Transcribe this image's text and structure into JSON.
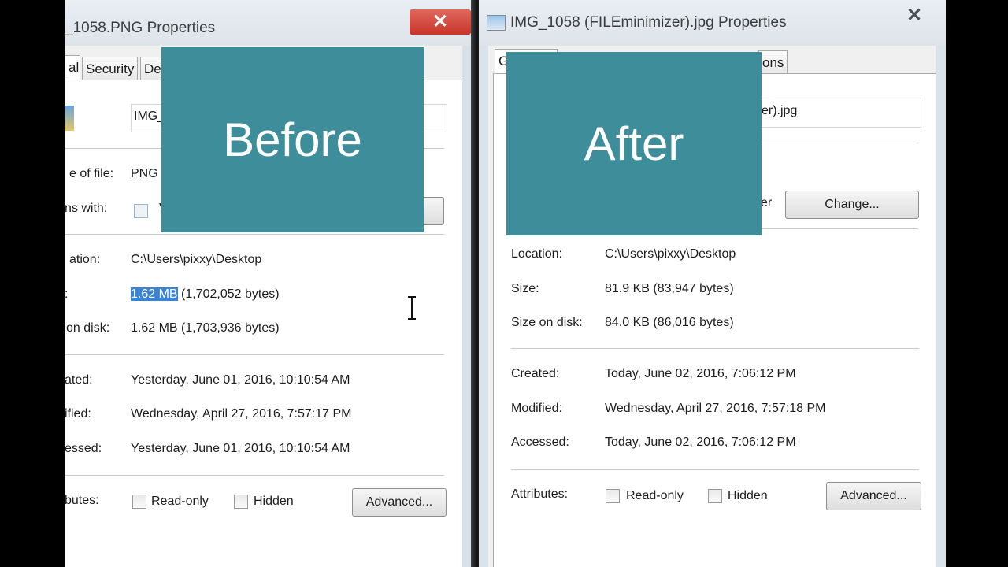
{
  "left": {
    "title": "_1058.PNG Properties",
    "tabs": [
      "al",
      "Security",
      "De"
    ],
    "filename": "IMG_",
    "type_label": "e of file:",
    "type_value": "PNG",
    "opens_label": "ns with:",
    "opens_value": "V",
    "location_label": "ation:",
    "location_value": "C:\\Users\\pixxy\\Desktop",
    "size_label": ":",
    "size_highlight": "1.62 MB",
    "size_rest": " (1,702,052 bytes)",
    "disk_label": "on disk:",
    "disk_value": "1.62 MB (1,703,936 bytes)",
    "created_label": "ated:",
    "created_value": "Yesterday, June 01, 2016, 10:10:54 AM",
    "modified_label": "ified:",
    "modified_value": "Wednesday, April 27, 2016, 7:57:17 PM",
    "accessed_label": "essed:",
    "accessed_value": "Yesterday, June 01, 2016, 10:10:54 AM",
    "attrib_label": "butes:",
    "readonly": "Read-only",
    "hidden": "Hidden",
    "advanced": "Advanced...",
    "overlay": "Before"
  },
  "right": {
    "title": "IMG_1058 (FILEminimizer).jpg Properties",
    "tabs": [
      "G",
      "ons"
    ],
    "filename_tail": "er).jpg",
    "opens_tail": "er",
    "change": "Change...",
    "location_label": "Location:",
    "location_value": "C:\\Users\\pixxy\\Desktop",
    "size_label": "Size:",
    "size_value": "81.9 KB (83,947 bytes)",
    "disk_label": "Size on disk:",
    "disk_value": "84.0 KB (86,016 bytes)",
    "created_label": "Created:",
    "created_value": "Today, June 02, 2016, 7:06:12 PM",
    "modified_label": "Modified:",
    "modified_value": "Wednesday, April 27, 2016, 7:57:18 PM",
    "accessed_label": "Accessed:",
    "accessed_value": "Today, June 02, 2016, 7:06:12 PM",
    "attrib_label": "Attributes:",
    "readonly": "Read-only",
    "hidden": "Hidden",
    "advanced": "Advanced...",
    "overlay": "After"
  },
  "close_glyph": "✕",
  "colors": {
    "overlay": "#3d8d9b",
    "close_red": "#c9342a",
    "selection": "#3a84d6"
  }
}
